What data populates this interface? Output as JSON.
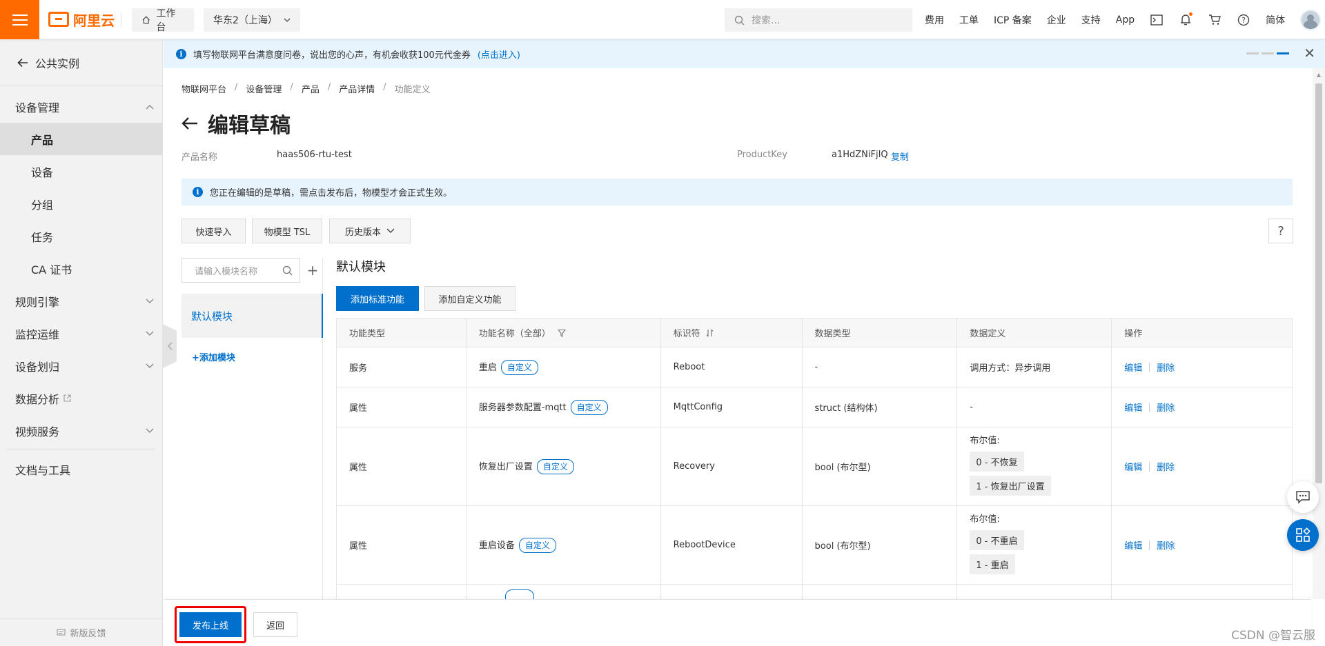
{
  "topbar": {
    "logo_text": "阿里云",
    "workbench": "工作台",
    "region": "华东2（上海）",
    "search_placeholder": "搜索...",
    "links": [
      "费用",
      "工单",
      "ICP 备案",
      "企业",
      "支持",
      "App"
    ],
    "lang": "简体"
  },
  "sidebar": {
    "back_label": "公共实例",
    "device_mgmt": "设备管理",
    "items": [
      "产品",
      "设备",
      "分组",
      "任务",
      "CA 证书"
    ],
    "rules": "规则引擎",
    "ops": "监控运维",
    "assign": "设备划归",
    "analytics": "数据分析",
    "video": "视频服务",
    "docs": "文档与工具",
    "feedback": "新版反馈"
  },
  "notice": {
    "text": "填写物联网平台满意度问卷，说出您的心声，有机会收获100元代金券",
    "link": "(点击进入)"
  },
  "breadcrumb": [
    "物联网平台",
    "设备管理",
    "产品",
    "产品详情",
    "功能定义"
  ],
  "page": {
    "title": "编辑草稿",
    "product_name_label": "产品名称",
    "product_name": "haas506-rtu-test",
    "product_key_label": "ProductKey",
    "product_key": "a1HdZNiFjIQ",
    "copy": "复制",
    "draft_notice": "您正在编辑的是草稿，需点击发布后，物模型才会正式生效。",
    "btn_quick_import": "快速导入",
    "btn_tsl": "物模型 TSL",
    "btn_history": "历史版本",
    "help": "?"
  },
  "modules": {
    "search_placeholder": "请输入模块名称",
    "default": "默认模块",
    "add": "+添加模块",
    "title": "默认模块",
    "btn_add_standard": "添加标准功能",
    "btn_add_custom": "添加自定义功能"
  },
  "table": {
    "headers": {
      "type": "功能类型",
      "name": "功能名称（全部）",
      "identifier": "标识符",
      "data_type": "数据类型",
      "data_def": "数据定义",
      "ops": "操作"
    },
    "tag": "自定义",
    "edit": "编辑",
    "delete": "删除",
    "rows": [
      {
        "type": "服务",
        "name": "重启",
        "identifier": "Reboot",
        "data_type": "-",
        "data_def": "调用方式：异步调用"
      },
      {
        "type": "属性",
        "name": "服务器参数配置-mqtt",
        "identifier": "MqttConfig",
        "data_type": "struct (结构体)",
        "data_def": "-"
      },
      {
        "type": "属性",
        "name": "恢复出厂设置",
        "identifier": "Recovery",
        "data_type": "bool (布尔型)",
        "data_def_label": "布尔值:",
        "enum0": "0 - 不恢复",
        "enum1": "1 - 恢复出厂设置"
      },
      {
        "type": "属性",
        "name": "重启设备",
        "identifier": "RebootDevice",
        "data_type": "bool (布尔型)",
        "data_def_label": "布尔值:",
        "enum0": "0 - 不重启",
        "enum1": "1 - 重启"
      }
    ]
  },
  "bottom": {
    "publish": "发布上线",
    "back": "返回"
  },
  "watermark": "CSDN @智云服",
  "colors": {
    "brand_orange": "#ff6a00",
    "primary_blue": "#0070cc",
    "highlight_red": "#e00000"
  }
}
